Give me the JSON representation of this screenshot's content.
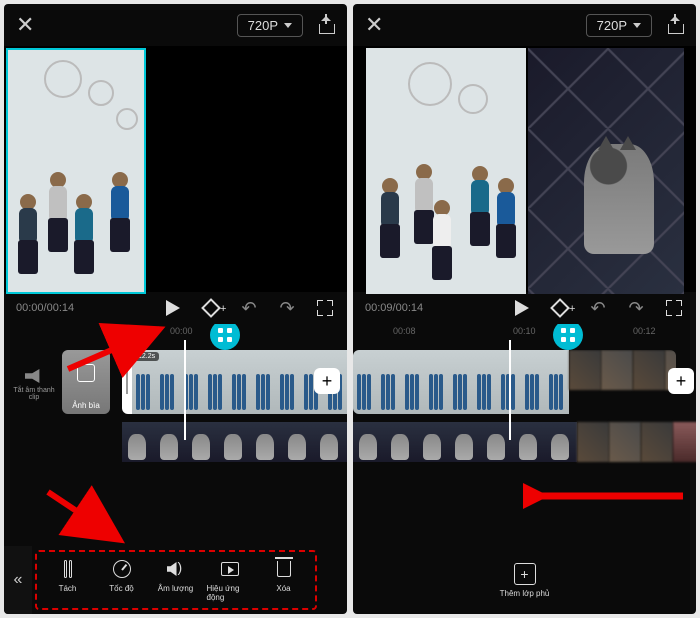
{
  "left": {
    "resolution": "720P",
    "time_current": "00:00",
    "time_total": "00:14",
    "ruler": {
      "t0": "00:00"
    },
    "clip_duration": "12.2s",
    "mute_label": "Tắt âm thanh clip",
    "cover_label": "Ảnh bìa",
    "tools": {
      "split": "Tách",
      "speed": "Tốc độ",
      "volume": "Âm lượng",
      "animation": "Hiệu ứng động",
      "delete": "Xóa"
    }
  },
  "right": {
    "resolution": "720P",
    "time_current": "00:09",
    "time_total": "00:14",
    "ruler": {
      "t0": "00:08",
      "t1": "00:10",
      "t2": "00:12"
    },
    "overlay_label": "Thêm lớp phủ"
  }
}
